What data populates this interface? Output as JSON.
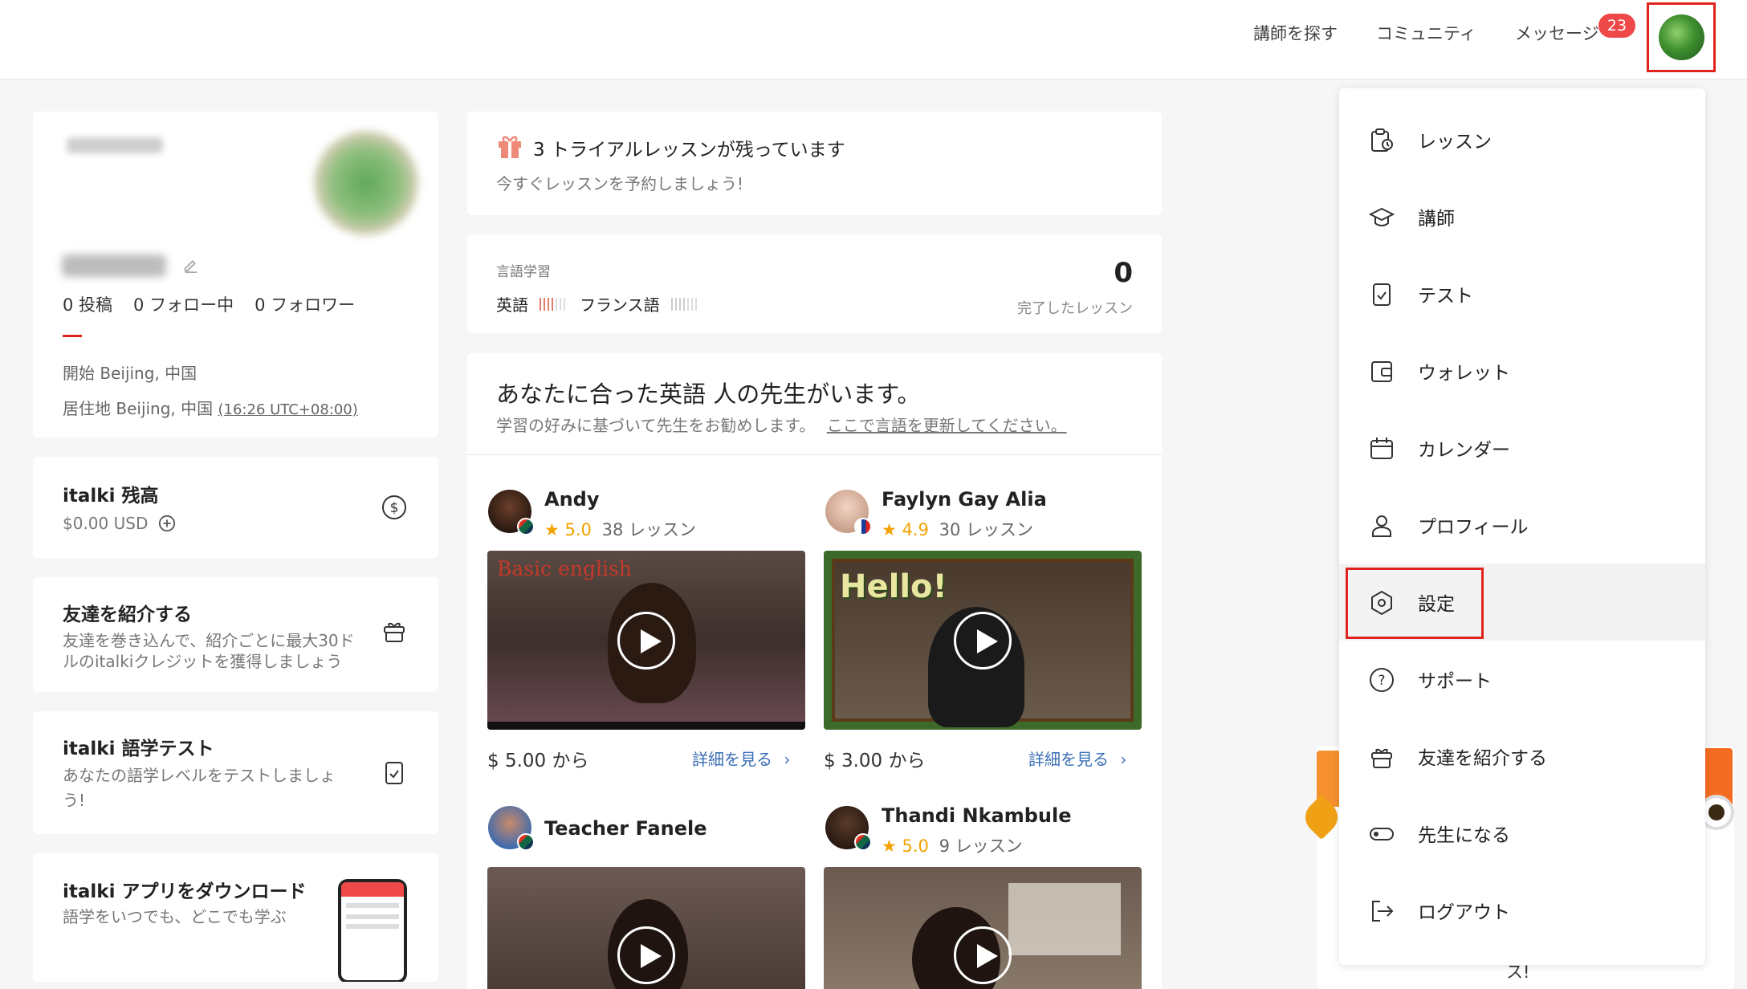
{
  "nav": {
    "find_teacher": "講師を探す",
    "community": "コミュニティ",
    "messages": "メッセージ",
    "badge": "23"
  },
  "profile": {
    "posts": "0 投稿",
    "following": "0 フォロー中",
    "followers": "0 フォロワー",
    "from": "開始 Beijing, 中国",
    "living_prefix": "居住地 Beijing, 中国",
    "timezone": "(16:26 UTC+08:00)"
  },
  "balance": {
    "title": "italki 残高",
    "amount": "$0.00 USD"
  },
  "refer": {
    "title": "友達を紹介する",
    "line1": "友達を巻き込んで、紹介ごとに最大30ド",
    "line2": "ルのitalkiクレジットを獲得しましょう"
  },
  "test": {
    "title": "italki 語学テスト",
    "line1": "あなたの語学レベルをテストしましょ",
    "line2": "う!"
  },
  "app": {
    "title": "italki アプリをダウンロード",
    "subtitle": "語学をいつでも、どこでも学ぶ"
  },
  "trial": {
    "title": "3 トライアルレッスンが残っています",
    "subtitle": "今すぐレッスンを予約しましょう!"
  },
  "learning": {
    "label": "言語学習",
    "lang1": "英語",
    "lang2": "フランス語",
    "count": "0",
    "count_label": "完了したレッスン"
  },
  "reco": {
    "title": "あなたに合った英語 人の先生がいます。",
    "subtitle": "学習の好みに基づいて先生をお勧めします。",
    "link": "ここで言語を更新してください。"
  },
  "teachers": [
    {
      "name": "Andy",
      "rating": "5.0",
      "lessons": "38 レッスン",
      "price": "$ 5.00 から",
      "detail": "詳細を見る",
      "video_text": "Basic english"
    },
    {
      "name": "Faylyn Gay Alia",
      "rating": "4.9",
      "lessons": "30 レッスン",
      "price": "$ 3.00 から",
      "detail": "詳細を見る",
      "video_text": "Hello!"
    },
    {
      "name": "Teacher Fanele"
    },
    {
      "name": "Thandi Nkambule",
      "rating": "5.0",
      "lessons": "9 レッスン"
    }
  ],
  "menu": {
    "items": [
      {
        "label": "レッスン",
        "icon": "lessons-icon"
      },
      {
        "label": "講師",
        "icon": "graduation-cap-icon"
      },
      {
        "label": "テスト",
        "icon": "test-icon"
      },
      {
        "label": "ウォレット",
        "icon": "wallet-icon"
      },
      {
        "label": "カレンダー",
        "icon": "calendar-icon"
      },
      {
        "label": "プロフィール",
        "icon": "user-icon"
      },
      {
        "label": "設定",
        "icon": "settings-icon"
      },
      {
        "label": "サポート",
        "icon": "help-icon"
      },
      {
        "label": "友達を紹介する",
        "icon": "gift-icon"
      },
      {
        "label": "先生になる",
        "icon": "toggle-icon"
      },
      {
        "label": "ログアウト",
        "icon": "logout-icon"
      }
    ]
  },
  "promo": {
    "tail_text": "ス!"
  },
  "colors": {
    "accent": "#ef4848",
    "highlight": "#e0231c",
    "link": "#3b6fb6",
    "star": "#f3a200"
  }
}
